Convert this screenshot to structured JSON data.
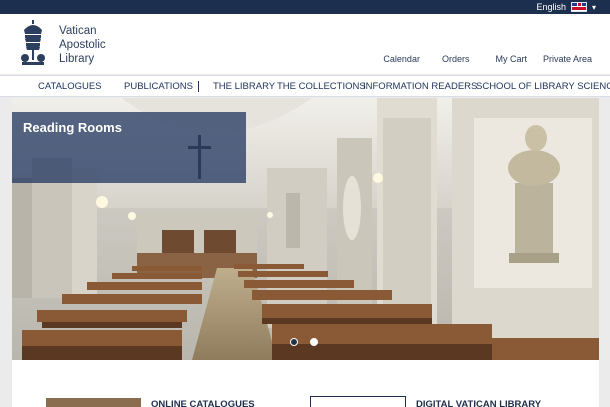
{
  "topbar": {
    "language": "English"
  },
  "header": {
    "brand": [
      "Vatican",
      "Apostolic",
      "Library"
    ],
    "utility_links": [
      "Calendar",
      "Orders",
      "My Cart",
      "Private Area"
    ]
  },
  "nav": {
    "items": [
      "CATALOGUES",
      "PUBLICATIONS",
      "THE LIBRARY",
      "THE COLLECTIONS",
      "INFORMATION READERS",
      "SCHOOL OF LIBRARY SCIENCE"
    ]
  },
  "hero": {
    "caption": "Reading Rooms"
  },
  "cards": {
    "online_catalogues": "ONLINE CATALOGUES",
    "digital_library": "DIGITAL VATICAN LIBRARY"
  }
}
